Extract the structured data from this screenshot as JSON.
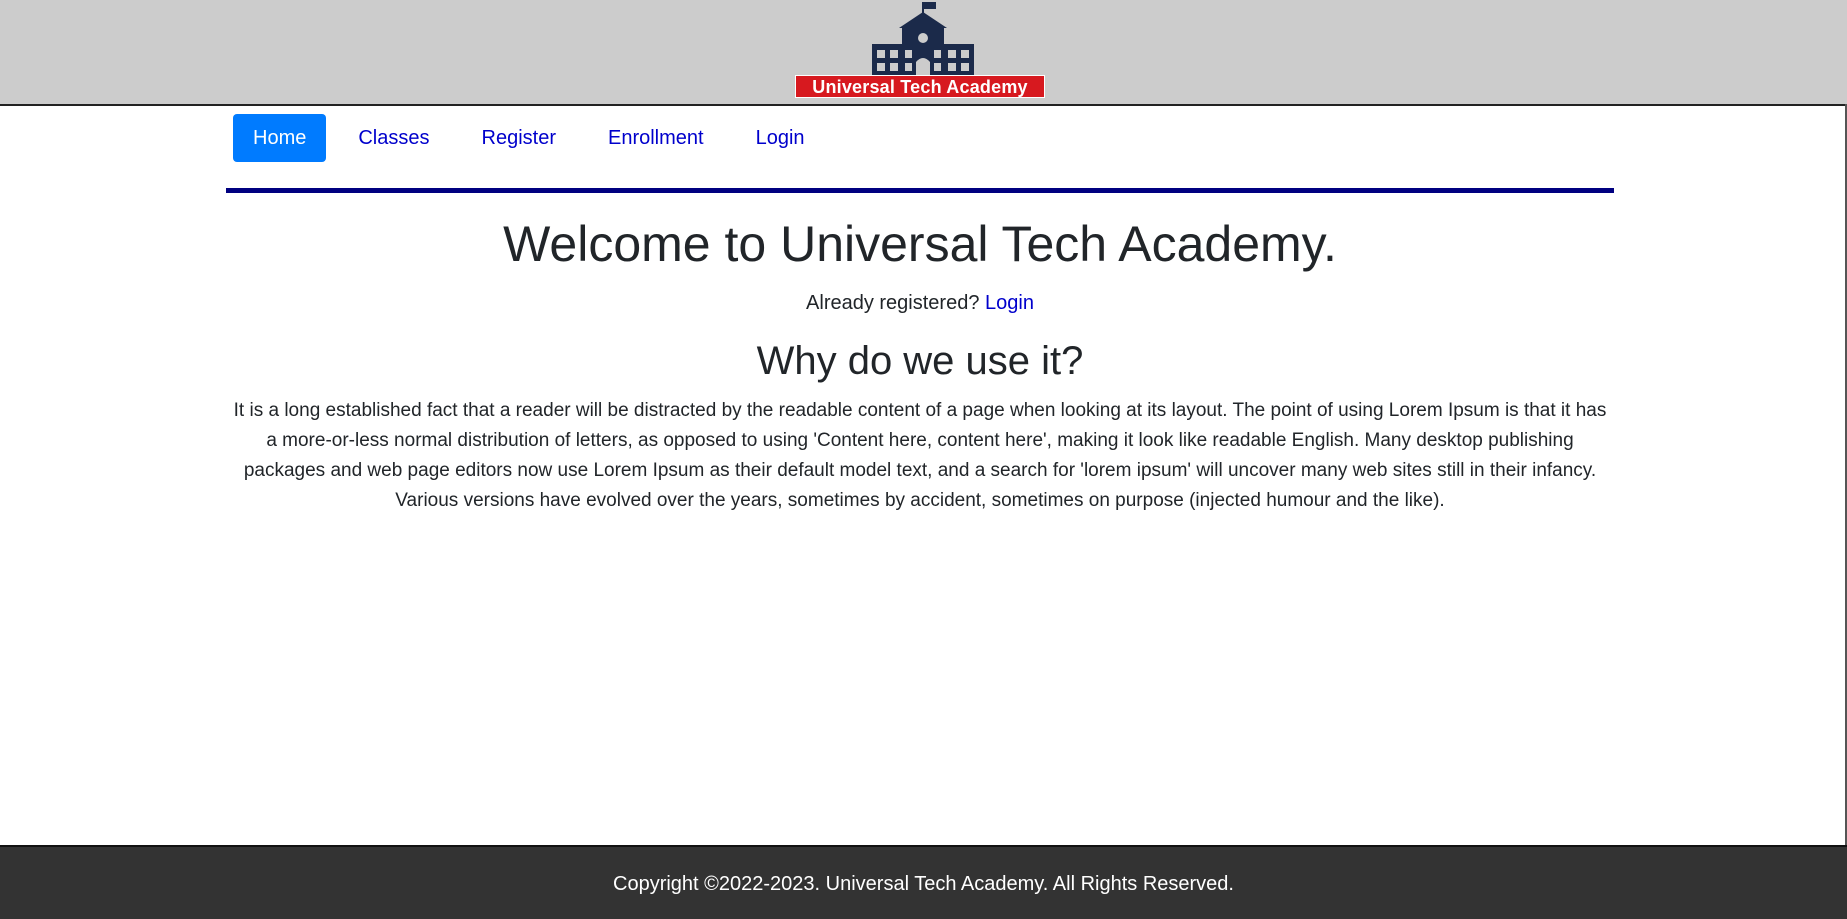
{
  "header": {
    "logo_text": "Universal Tech Academy",
    "logo_icon": "school-building-icon",
    "colors": {
      "background": "#cccccc",
      "banner": "#d7191f",
      "building": "#1b2a4a"
    }
  },
  "nav": {
    "items": [
      {
        "label": "Home",
        "active": true
      },
      {
        "label": "Classes",
        "active": false
      },
      {
        "label": "Register",
        "active": false
      },
      {
        "label": "Enrollment",
        "active": false
      },
      {
        "label": "Login",
        "active": false
      }
    ],
    "colors": {
      "active_bg": "#007bff",
      "link": "#0000cc",
      "rule": "#000080"
    }
  },
  "main": {
    "title": "Welcome to Universal Tech Academy.",
    "already_registered": "Already registered?",
    "login_link": "Login",
    "section_title": "Why do we use it?",
    "paragraph": "It is a long established fact that a reader will be distracted by the readable content of a page when looking at its layout. The point of using Lorem Ipsum is that it has a more-or-less normal distribution of letters, as opposed to using 'Content here, content here', making it look like readable English. Many desktop publishing packages and web page editors now use Lorem Ipsum as their default model text, and a search for 'lorem ipsum' will uncover many web sites still in their infancy. Various versions have evolved over the years, sometimes by accident, sometimes on purpose (injected humour and the like)."
  },
  "footer": {
    "copyright": "Copyright ©2022-2023. Universal Tech Academy. All Rights Reserved.",
    "colors": {
      "background": "#333333"
    }
  }
}
